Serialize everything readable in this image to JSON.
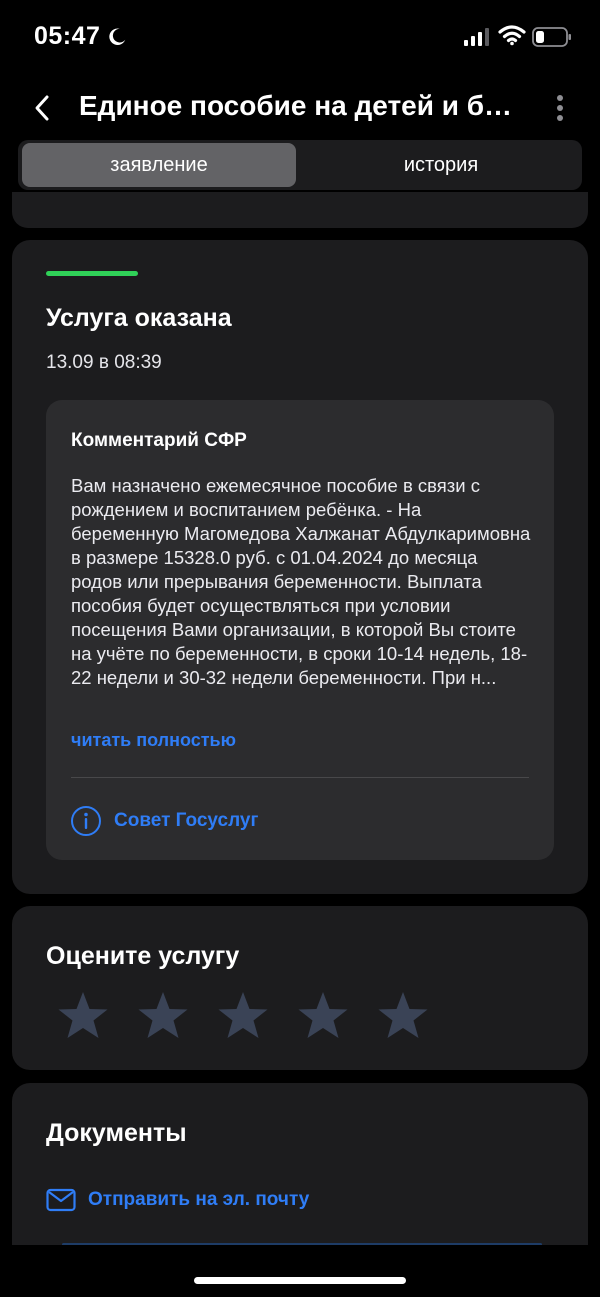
{
  "status_bar": {
    "time": "05:47",
    "icons": [
      "moon-icon",
      "signal-icon",
      "wifi-icon",
      "battery-icon"
    ]
  },
  "nav": {
    "title": "Единое пособие на детей и бе...",
    "back_icon": "chevron-left-icon",
    "more_icon": "more-vertical-icon"
  },
  "tabs": [
    {
      "label": "заявление",
      "active": true
    },
    {
      "label": "история",
      "active": false
    }
  ],
  "status_card": {
    "accent_color": "#30d158",
    "title": "Услуга оказана",
    "date": "13.09 в 08:39",
    "comment": {
      "title": "Комментарий СФР",
      "text": "Вам назначено ежемесячное пособие в связи с рождением и воспитанием ребёнка. - На беременную Магомедова Халжанат Абдулкаримовна в размере 15328.0 руб. с 01.04.2024 до месяца родов или прерывания беременности. Выплата пособия будет осуществляться при условии посещения Вами организации, в которой Вы стоите на учёте по беременности, в сроки 10-14 недель, 18-22 недели и 30-32 недели беременности. При н...",
      "read_more": "читать полностью"
    },
    "advice": {
      "icon": "info-icon",
      "label": "Совет Госуслуг"
    }
  },
  "rating": {
    "title": "Оцените услугу",
    "stars_total": 5,
    "stars_selected": 0
  },
  "documents": {
    "title": "Документы",
    "send_email": {
      "icon": "mail-icon",
      "label": "Отправить на эл. почту"
    }
  },
  "colors": {
    "background": "#000000",
    "card": "#1c1c1e",
    "inner_card": "#2c2c2e",
    "link": "#2f7df6",
    "star": "#3a4356"
  }
}
